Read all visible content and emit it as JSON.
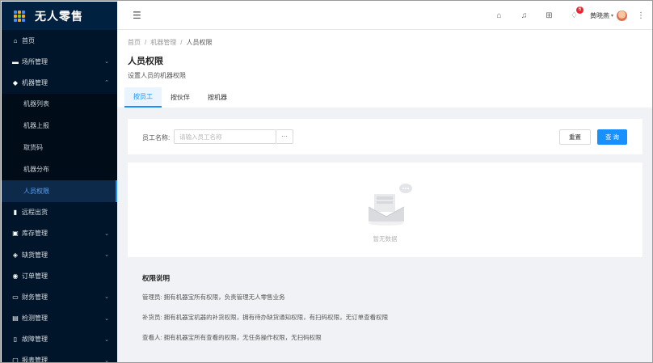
{
  "app": {
    "title": "无人零售"
  },
  "sidebar": {
    "items": [
      {
        "label": "首页",
        "icon": "home-icon",
        "glyph": "⌂",
        "has_children": false
      },
      {
        "label": "场所管理",
        "icon": "store-icon",
        "glyph": "▬",
        "has_children": true,
        "expanded": false
      },
      {
        "label": "机器管理",
        "icon": "android-icon",
        "glyph": "◆",
        "has_children": true,
        "expanded": true,
        "children": [
          {
            "label": "机器列表",
            "active": false
          },
          {
            "label": "机器上报",
            "active": false
          },
          {
            "label": "取货码",
            "active": false
          },
          {
            "label": "机器分布",
            "active": false
          },
          {
            "label": "人员权限",
            "active": true
          }
        ]
      },
      {
        "label": "远程出货",
        "icon": "bottle-icon",
        "glyph": "▮",
        "has_children": false
      },
      {
        "label": "库存管理",
        "icon": "inventory-icon",
        "glyph": "▣",
        "has_children": true,
        "expanded": false
      },
      {
        "label": "缺货管理",
        "icon": "shortage-icon",
        "glyph": "◈",
        "has_children": true,
        "expanded": false
      },
      {
        "label": "订单管理",
        "icon": "order-icon",
        "glyph": "◉",
        "has_children": false
      },
      {
        "label": "财务管理",
        "icon": "finance-icon",
        "glyph": "▭",
        "has_children": true,
        "expanded": false
      },
      {
        "label": "检测管理",
        "icon": "inspection-icon",
        "glyph": "▤",
        "has_children": true,
        "expanded": false
      },
      {
        "label": "故障管理",
        "icon": "fault-icon",
        "glyph": "▯",
        "has_children": true,
        "expanded": false
      },
      {
        "label": "报表管理",
        "icon": "report-icon",
        "glyph": "▢",
        "has_children": true,
        "expanded": false
      }
    ]
  },
  "header": {
    "notification_count": "6",
    "username": "黄晓燕"
  },
  "breadcrumb": [
    "首页",
    "机器管理",
    "人员权限"
  ],
  "page": {
    "title": "人员权限",
    "subtitle": "设置人员的机器权限"
  },
  "tabs": [
    {
      "label": "按员工",
      "active": true
    },
    {
      "label": "按伙伴",
      "active": false
    },
    {
      "label": "按机器",
      "active": false
    }
  ],
  "search": {
    "label": "员工名称:",
    "placeholder": "请输入员工名称",
    "value": "",
    "more_label": "···",
    "reset_label": "重置",
    "query_label": "查 询"
  },
  "empty": {
    "text": "暂无数据"
  },
  "permissions": {
    "title": "权限说明",
    "lines": [
      "管理员:  拥有机器宝所有权限，负责管理无人零售业务",
      "补货员:  拥有机器宝机器的补货权限，拥有待办缺货通知权限，有扫码权限，无订单查看权限",
      "查看人:  拥有机器宝所有查看的权限，无任务操作权限，无扫码权限"
    ]
  },
  "colors": {
    "sidebar_bg": "#001529",
    "accent": "#1890ff",
    "badge": "#f5222d"
  }
}
